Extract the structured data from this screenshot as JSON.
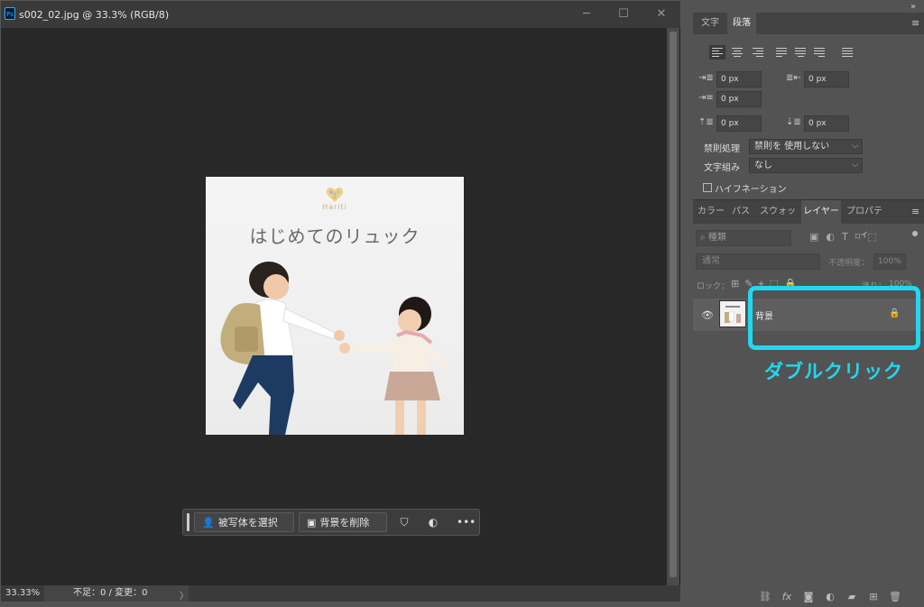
{
  "document": {
    "title": "s002_02.jpg @ 33.3% (RGB/8)",
    "app_badge": "Ps",
    "window_controls": [
      "─",
      "☐",
      "✕"
    ],
    "zoom_level": "33.33%",
    "doc_status": "不足：0 / 変更：0",
    "status_arrow": "〉"
  },
  "image": {
    "logo": "Hariti",
    "headline": "はじめてのリュック"
  },
  "taskbar": {
    "select_subject": "被写体を選択",
    "remove_background": "背景を削除",
    "more": "•••"
  },
  "paragraph_panel": {
    "tabs": [
      "文字",
      "段落"
    ],
    "active_tab": "段落",
    "indent_left": "0 px",
    "indent_right": "0 px",
    "indent_first": "0 px",
    "space_before": "0 px",
    "space_after": "0 px",
    "kinsoku_label": "禁則処理",
    "kinsoku_value": "禁則を 使用しない",
    "mojikumi_label": "文字組み",
    "mojikumi_value": "なし",
    "hyphenation_label": "ハイフネーション"
  },
  "layers_panel": {
    "tabs": [
      "カラー",
      "パス",
      "スウォッチ",
      "レイヤー",
      "プロパティ"
    ],
    "active_tab": "レイヤー",
    "filter_placeholder": "種類",
    "blend_mode": "通常",
    "opacity_label": "不透明度：",
    "opacity_value": "100%",
    "lock_label": "ロック：",
    "fill_label": "塗り：",
    "fill_value": "100%",
    "layer_name": "背景"
  },
  "annotation": "ダブルクリック",
  "colors": {
    "highlight": "#20d8f0",
    "panel_bg": "#535353",
    "canvas_bg": "#282828"
  }
}
